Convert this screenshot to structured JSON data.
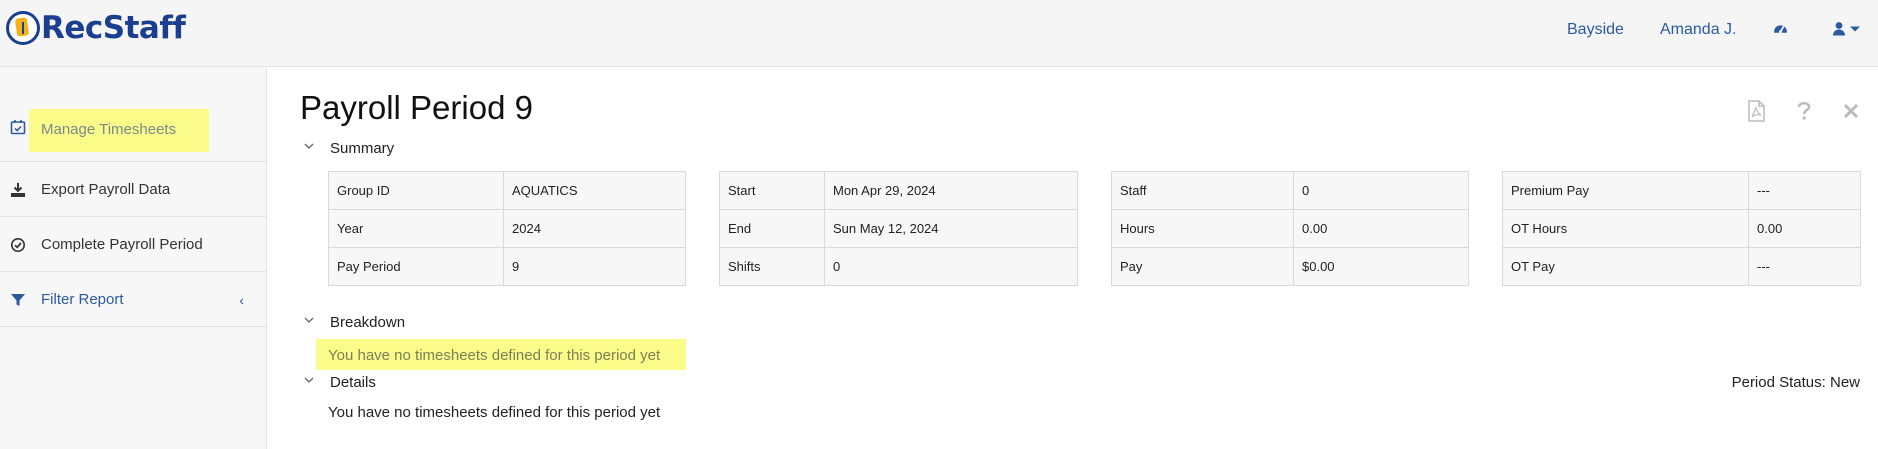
{
  "app": {
    "logo_text": "RecStaff"
  },
  "nav": {
    "location": "Bayside",
    "user": "Amanda J.",
    "dashboard_icon": "dashboard-icon",
    "user_menu_icon": "user-icon"
  },
  "sidebar": {
    "items": [
      {
        "label": "Manage Timesheets",
        "icon": "calendar-check-icon",
        "active": true
      },
      {
        "label": "Export Payroll Data",
        "icon": "download-icon"
      },
      {
        "label": "Complete Payroll Period",
        "icon": "check-circle-icon"
      },
      {
        "label": "Filter Report",
        "icon": "filter-icon"
      }
    ]
  },
  "page": {
    "title": "Payroll Period 9",
    "toolbar_icons": [
      "pdf-icon",
      "help-icon",
      "close-icon"
    ]
  },
  "summary": {
    "heading": "Summary",
    "tables": [
      [
        [
          "Group ID",
          "AQUATICS"
        ],
        [
          "Year",
          "2024"
        ],
        [
          "Pay Period",
          "9"
        ]
      ],
      [
        [
          "Start",
          "Mon Apr 29, 2024"
        ],
        [
          "End",
          "Sun May 12, 2024"
        ],
        [
          "Shifts",
          "0"
        ]
      ],
      [
        [
          "Staff",
          "0"
        ],
        [
          "Hours",
          "0.00"
        ],
        [
          "Pay",
          "$0.00"
        ]
      ],
      [
        [
          "Premium Pay",
          "---"
        ],
        [
          "OT Hours",
          "0.00"
        ],
        [
          "OT Pay",
          "---"
        ]
      ]
    ]
  },
  "breakdown": {
    "heading": "Breakdown",
    "message": "You have no timesheets defined for this period yet"
  },
  "details": {
    "heading": "Details",
    "message": "You have no timesheets defined for this period yet",
    "period_status": "Period Status: New"
  },
  "colors": {
    "brand": "#1b3f8f",
    "link": "#2c5aa0",
    "highlight": "#fafb88"
  }
}
